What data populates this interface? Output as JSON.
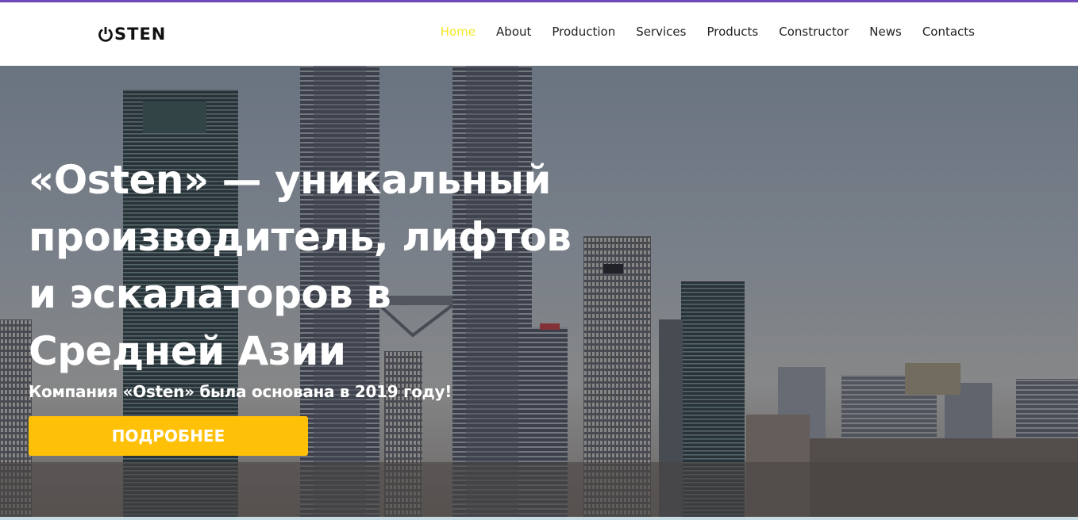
{
  "brand": {
    "logo_text": "STEN",
    "logo_icon": "power-o-icon"
  },
  "nav": {
    "items": [
      {
        "label": "Home",
        "active": true
      },
      {
        "label": "About"
      },
      {
        "label": "Production"
      },
      {
        "label": "Services"
      },
      {
        "label": "Products"
      },
      {
        "label": "Constructor"
      },
      {
        "label": "News"
      },
      {
        "label": "Contacts"
      }
    ]
  },
  "hero": {
    "title": "«Osten» — уникальный производитель, лифтов и эскалаторов в Средней Азии",
    "subtitle": "Компания «Osten» была основана в 2019 году!",
    "button_label": "ПОДРОБНЕЕ"
  },
  "colors": {
    "accent_top_line": "#6f4ab8",
    "nav_active": "#f6e726",
    "button": "#ffc107"
  }
}
